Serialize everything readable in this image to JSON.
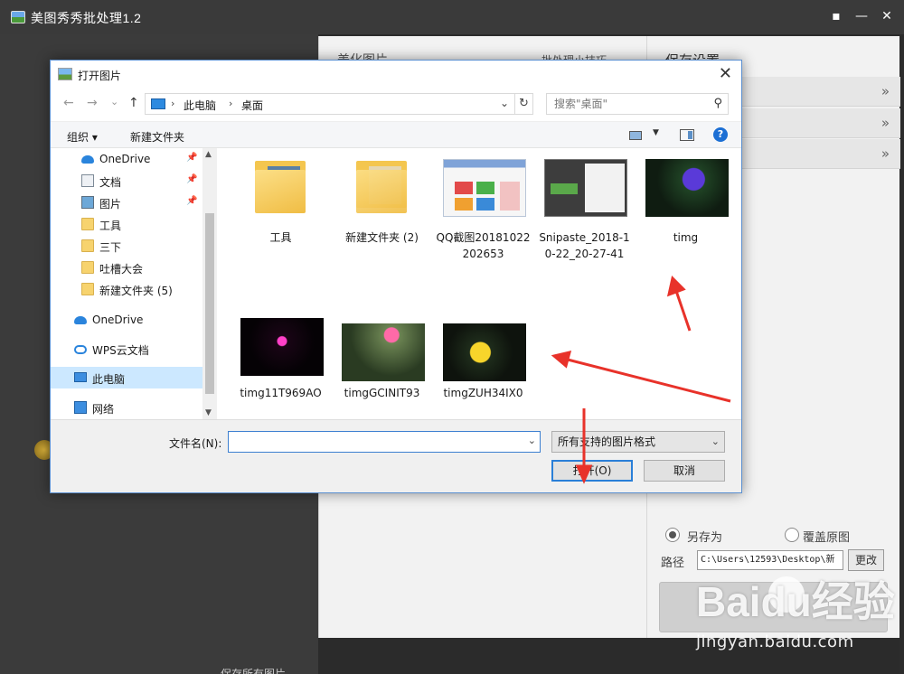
{
  "app": {
    "title": "美图秀秀批处理1.2",
    "titlebar_buttons": {
      "feedback": "▪",
      "minimize": "—",
      "close": "✕"
    }
  },
  "main_panel": {
    "center_title": "美化图片",
    "center_link": "批处理小技巧",
    "save_settings": {
      "title": "保存设置",
      "chevron": "»",
      "option_save_as": "另存为",
      "option_overwrite": "覆盖原图",
      "save_as_selected": true,
      "path_label": "路径",
      "path_value": "C:\\Users\\12593\\Desktop\\新",
      "change_button": "更改"
    },
    "bottom_peek": "保存所有图片"
  },
  "dialog": {
    "title": "打开图片",
    "close": "✕",
    "nav": {
      "back": "←",
      "forward": "→",
      "dropdown": "⌄",
      "up": "↑"
    },
    "breadcrumb": [
      "此电脑",
      "桌面"
    ],
    "breadcrumb_sep": "›",
    "address_dropdown": "⌄",
    "refresh": "↻",
    "search_placeholder": "搜索\"桌面\"",
    "search_icon": "⚲",
    "toolbar": {
      "organize": "组织 ▾",
      "new_folder": "新建文件夹",
      "view_dropdown": "▼",
      "help": "?"
    },
    "nav_pane": [
      {
        "label": "OneDrive",
        "icon": "cloud-icon",
        "pinned": true
      },
      {
        "label": "文档",
        "icon": "document-icon",
        "pinned": true
      },
      {
        "label": "图片",
        "icon": "picture-icon",
        "pinned": true
      },
      {
        "label": "工具",
        "icon": "folder-icon",
        "pinned": false
      },
      {
        "label": "三下",
        "icon": "folder-icon",
        "pinned": false
      },
      {
        "label": "吐槽大会",
        "icon": "folder-icon",
        "pinned": false
      },
      {
        "label": "新建文件夹 (5)",
        "icon": "folder-icon",
        "pinned": false
      },
      {
        "label": "OneDrive",
        "icon": "cloud-icon",
        "pinned": false
      },
      {
        "label": "WPS云文档",
        "icon": "wps-cloud-icon",
        "pinned": false
      },
      {
        "label": "此电脑",
        "icon": "computer-icon",
        "pinned": false,
        "selected": true
      },
      {
        "label": "网络",
        "icon": "network-icon",
        "pinned": false
      }
    ],
    "pin_glyph": "📌",
    "scroll": {
      "up": "▲",
      "down": "▼"
    },
    "files": [
      {
        "name": "工具",
        "kind": "folder"
      },
      {
        "name": "新建文件夹 (2)",
        "kind": "folder"
      },
      {
        "name": "QQ截图20181022202653",
        "kind": "screenshot"
      },
      {
        "name": "Snipaste_2018-10-22_20-27-41",
        "kind": "screenshot"
      },
      {
        "name": "timg",
        "kind": "image"
      },
      {
        "name": "timg11T969AO",
        "kind": "image"
      },
      {
        "name": "timgGCINIT93",
        "kind": "image"
      },
      {
        "name": "timgZUH34IX0",
        "kind": "image"
      }
    ],
    "filename_label": "文件名(N):",
    "filename_value": "",
    "filename_dropdown": "⌄",
    "filetype": "所有支持的图片格式",
    "filetype_dropdown": "⌄",
    "open_button": "打开(O)",
    "cancel_button": "取消"
  },
  "watermark": {
    "brand": "Baidu经验",
    "url": "jingyan.baidu.com"
  },
  "colors": {
    "dialog_border": "#5a8fd0",
    "selection": "#cce8ff",
    "annotation_arrow": "#e8322a",
    "app_dark": "#3a3a3a"
  }
}
